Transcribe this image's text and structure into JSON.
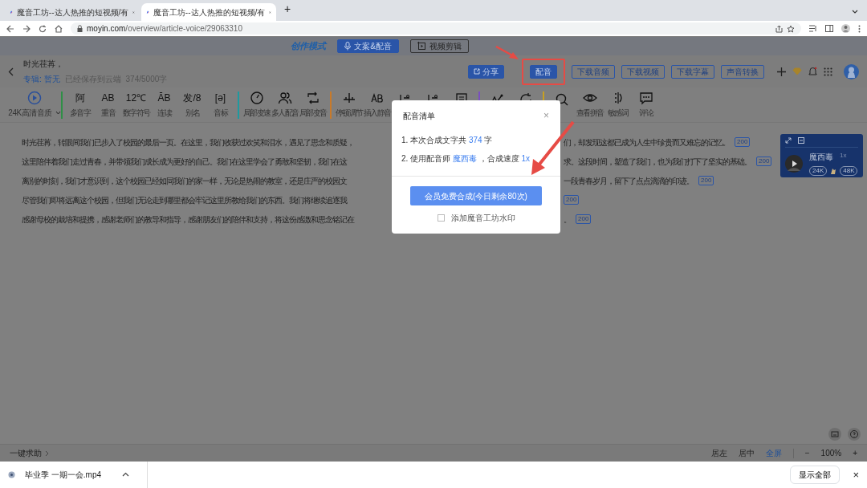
{
  "browser": {
    "tabs": [
      {
        "title": "魔音工坊--达人热推的短视频/有",
        "selected": false
      },
      {
        "title": "魔音工坊--达人热推的短视频/有",
        "selected": true
      }
    ],
    "new_tab": "+",
    "url_host": "moyin.com",
    "url_path": "/overview/article-voice/29063310"
  },
  "app_header": {
    "logo": "创作模式",
    "modes": [
      {
        "label": "文案&配音",
        "selected": true
      },
      {
        "label": "视频剪辑",
        "selected": false
      }
    ]
  },
  "document": {
    "title": "时光荏苒，",
    "album_label": "专辑:",
    "album_value": "暂无",
    "save_status": "已经保存到云端",
    "count": "374/5000字"
  },
  "actions": [
    {
      "label": "分享",
      "kind": "share",
      "highlighted": false
    },
    {
      "label": "配音",
      "kind": "primary",
      "highlighted": true
    },
    {
      "label": "下载音频",
      "kind": "outline",
      "highlighted": false
    },
    {
      "label": "下载视频",
      "kind": "outline",
      "highlighted": false
    },
    {
      "label": "下载字幕",
      "kind": "outline",
      "highlighted": false
    },
    {
      "label": "声音转换",
      "kind": "outline",
      "highlighted": false
    }
  ],
  "toolbar": [
    {
      "color": "#2f8f46",
      "tools": [
        {
          "kind": "quality",
          "label": "24K高清音质"
        }
      ]
    },
    {
      "color": "#1e9aa0",
      "tools": [
        {
          "kind": "glyph",
          "glyph": "阿",
          "label": "多音字"
        },
        {
          "kind": "glyph",
          "glyph": "AB",
          "label": "重音"
        },
        {
          "kind": "glyph",
          "glyph": "12℃",
          "label": "数字符号"
        },
        {
          "kind": "glyph",
          "glyph": "ĀB",
          "label": "连读"
        },
        {
          "kind": "glyph",
          "glyph": "发/8",
          "label": "别名"
        },
        {
          "kind": "glyph",
          "glyph": "[ə]",
          "label": "音标"
        }
      ]
    },
    {
      "color": "#c87a2a",
      "tools": [
        {
          "kind": "gauge",
          "label": "局部变速"
        },
        {
          "kind": "people",
          "label": "多人配音"
        },
        {
          "kind": "swap",
          "label": "局部变音"
        }
      ]
    },
    {
      "color": "#7a4fc0",
      "tools": [
        {
          "kind": "pause",
          "label": "停顿调节"
        },
        {
          "kind": "insert",
          "label": "插入静音"
        },
        {
          "kind": "tune"
        },
        {
          "kind": "tune"
        },
        {
          "kind": "doc"
        }
      ]
    },
    {
      "color": "#c8a020",
      "tools": [
        {
          "kind": "wave"
        },
        {
          "kind": "refresh"
        }
      ]
    },
    {
      "tools": [
        {
          "kind": "search"
        },
        {
          "kind": "eye",
          "label": "查看拼音"
        },
        {
          "kind": "scan",
          "label": "敏感词"
        },
        {
          "kind": "chat",
          "label": "评论"
        }
      ]
    }
  ],
  "paragraphs": [
    {
      "left": "时光荏苒，转眼间我们已步入了校园的最后一页。在这里，我们收获过欢笑和泪水，遇见了思念和质疑，",
      "right": "们，却发现这都已成为人生中珍贵而又难忘的记忆。",
      "count": "200"
    },
    {
      "left": "这里陪伴着我们走过青春，并带领我们成长成为更好的自己。我们在这里学会了勇敢和坚韧，我们在这",
      "right": "求。这段时间，塑造了我们，也为我们打下了坚实的基础。",
      "count": "200"
    },
    {
      "left": "离别的时刻，我们才意识到，这个校园已经如同我们的家一样，无论是热闹的教室，还是庄严的校园文",
      "right": "一段青春岁月，留下了点点滴滴的印迹。",
      "count": "200"
    },
    {
      "left": "尽管我们即将远离这个校园，但我们无论走到哪里都会牢记这里所教给我们的东西。我们将继续追逐我",
      "count": "200"
    },
    {
      "left": "感谢母校的栽培和提携，感谢老师们的教导和指导，感谢朋友们的陪伴和支持，将这份感激和思念铭记在",
      "right": "。",
      "count": "200"
    }
  ],
  "voice_panel": {
    "name": "魔西毒",
    "speed": "1x",
    "tags": [
      "24K",
      "48K"
    ]
  },
  "modal": {
    "title": "配音清单",
    "close": "×",
    "lines": [
      [
        {
          "text": "1. 本次合成文字共 ",
          "highlight": false
        },
        {
          "text": "374",
          "highlight": true
        },
        {
          "text": " 字",
          "highlight": false
        }
      ],
      [
        {
          "text": "2. 使用配音师 ",
          "highlight": false
        },
        {
          "text": "魔西毒",
          "highlight": true
        },
        {
          "text": " ，合成速度 ",
          "highlight": false
        },
        {
          "text": "1x",
          "highlight": true
        }
      ]
    ],
    "submit": "会员免费合成(今日剩余80次)",
    "watermark": {
      "label": "添加魔音工坊水印",
      "checked": false
    }
  },
  "bottom_bar": {
    "help": "一键求助",
    "align": [
      {
        "label": "居左",
        "selected": false
      },
      {
        "label": "居中",
        "selected": false
      },
      {
        "label": "全屏",
        "selected": true
      }
    ],
    "zoom_out": "−",
    "zoom": "100%",
    "zoom_in": "+"
  },
  "download_bar": {
    "file": "毕业季 一期一会.mp4",
    "show_all": "显示全部",
    "close": "×"
  }
}
